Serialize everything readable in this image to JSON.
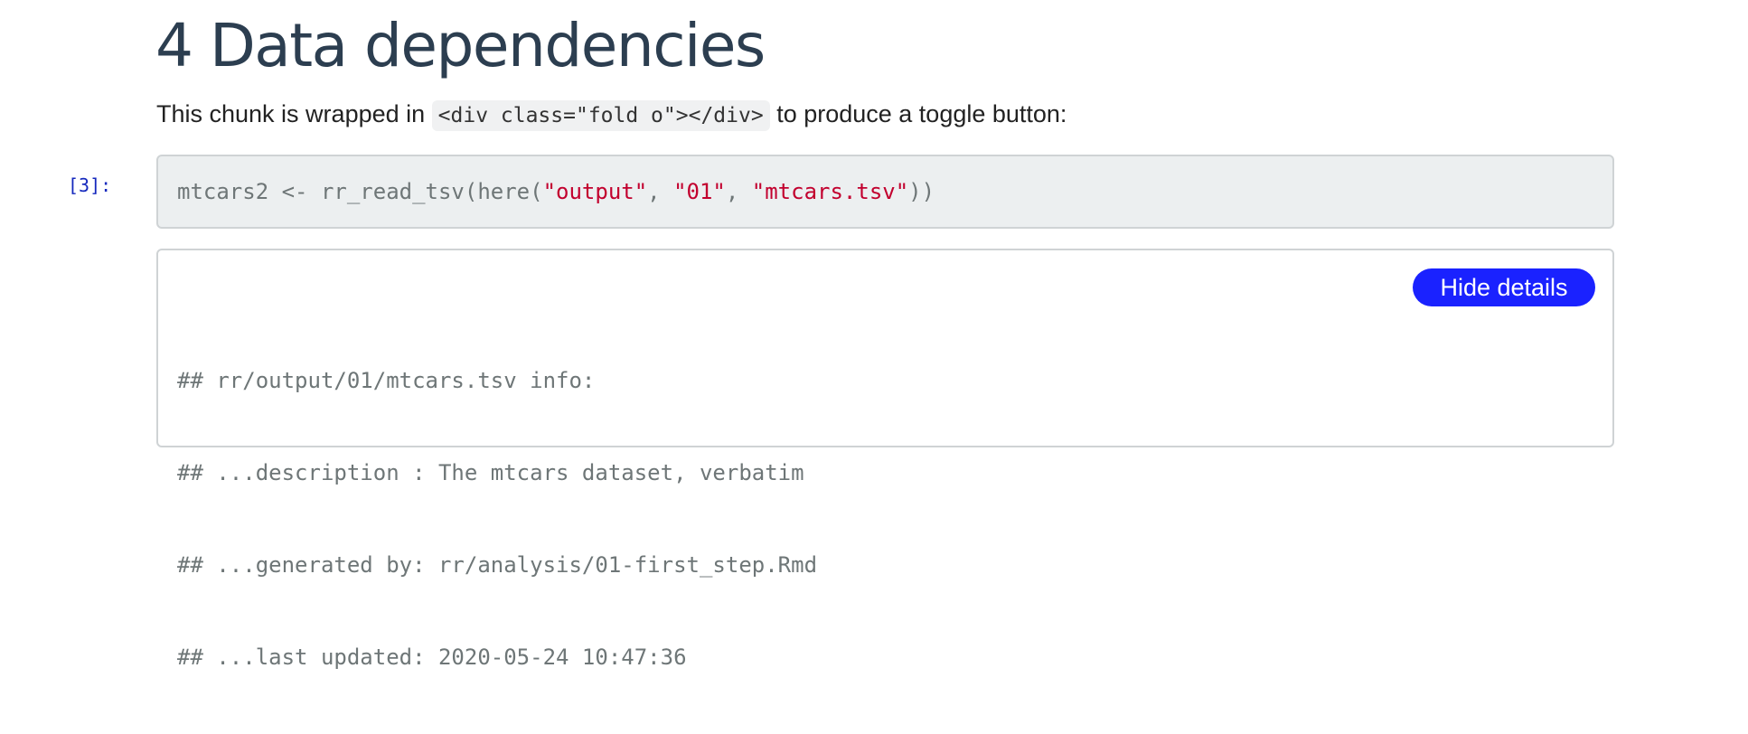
{
  "heading": {
    "title": "4 Data dependencies"
  },
  "intro": {
    "text_before": "This chunk is wrapped in ",
    "code": "<div class=\"fold o\"></div>",
    "text_after": " to produce a toggle button:"
  },
  "code_cell": {
    "prompt": "[3]:",
    "tokens": {
      "t1": "mtcars2 <- rr_read_tsv(here(",
      "s1": "\"output\"",
      "t2": ", ",
      "s2": "\"01\"",
      "t3": ", ",
      "s3": "\"mtcars.tsv\"",
      "t4": "))"
    }
  },
  "output_cell": {
    "toggle_label": "Hide details",
    "lines": [
      "## rr/output/01/mtcars.tsv info:",
      "## ...description : The mtcars dataset, verbatim",
      "## ...generated by: rr/analysis/01-first_step.Rmd",
      "## ...last updated: 2020-05-24 10:47:36"
    ]
  },
  "colors": {
    "heading": "#2c3e50",
    "prompt": "#1428bd",
    "string_literal": "#c2002e",
    "button_bg": "#1a22ff",
    "code_bg": "#eceff0"
  }
}
